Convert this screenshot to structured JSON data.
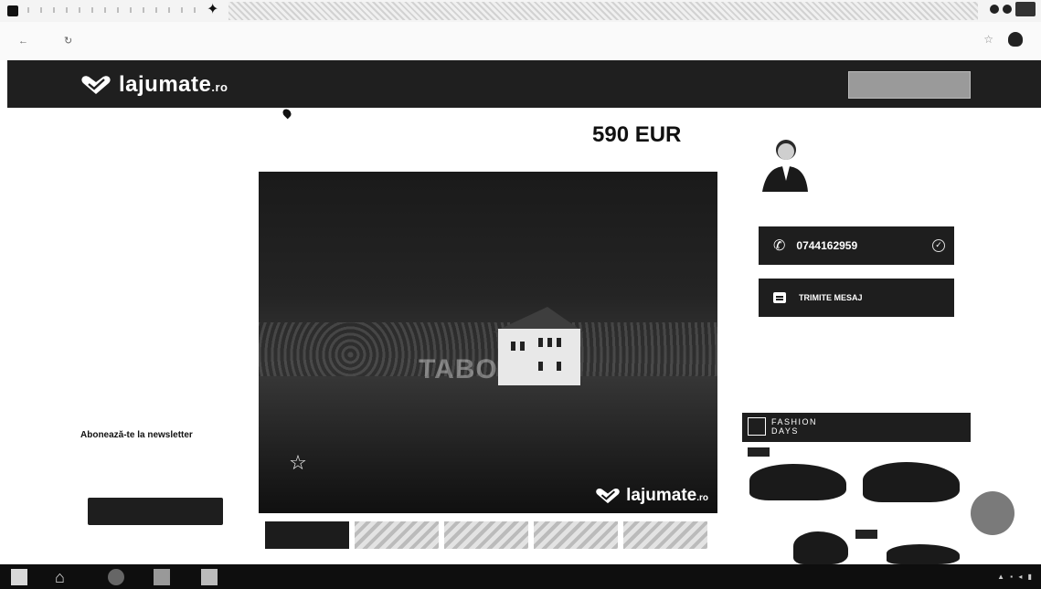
{
  "site": {
    "logo_text": "lajumate",
    "logo_suffix": ".ro",
    "post_button": "",
    "nav": [
      "",
      "",
      ""
    ]
  },
  "sidebar": {
    "title": "",
    "categories": [
      "",
      "",
      "",
      "",
      "",
      "",
      "",
      "",
      ""
    ],
    "promo_text": "",
    "newsletter": "Abonează-te la newsletter",
    "subscribe_button": ""
  },
  "listing": {
    "price": "590 EUR",
    "location": "",
    "photo_watermark": "TABO",
    "favorite_label": ""
  },
  "agent": {
    "name": "",
    "phone": "0744162959",
    "message_button": "TRIMITE MESAJ",
    "more_ads": ""
  },
  "ad": {
    "brand_line1": "FASHION",
    "brand_line2": "DAYS"
  },
  "colors": {
    "header_bg": "#1f1f1f",
    "button_bg": "#1e1e1e"
  }
}
